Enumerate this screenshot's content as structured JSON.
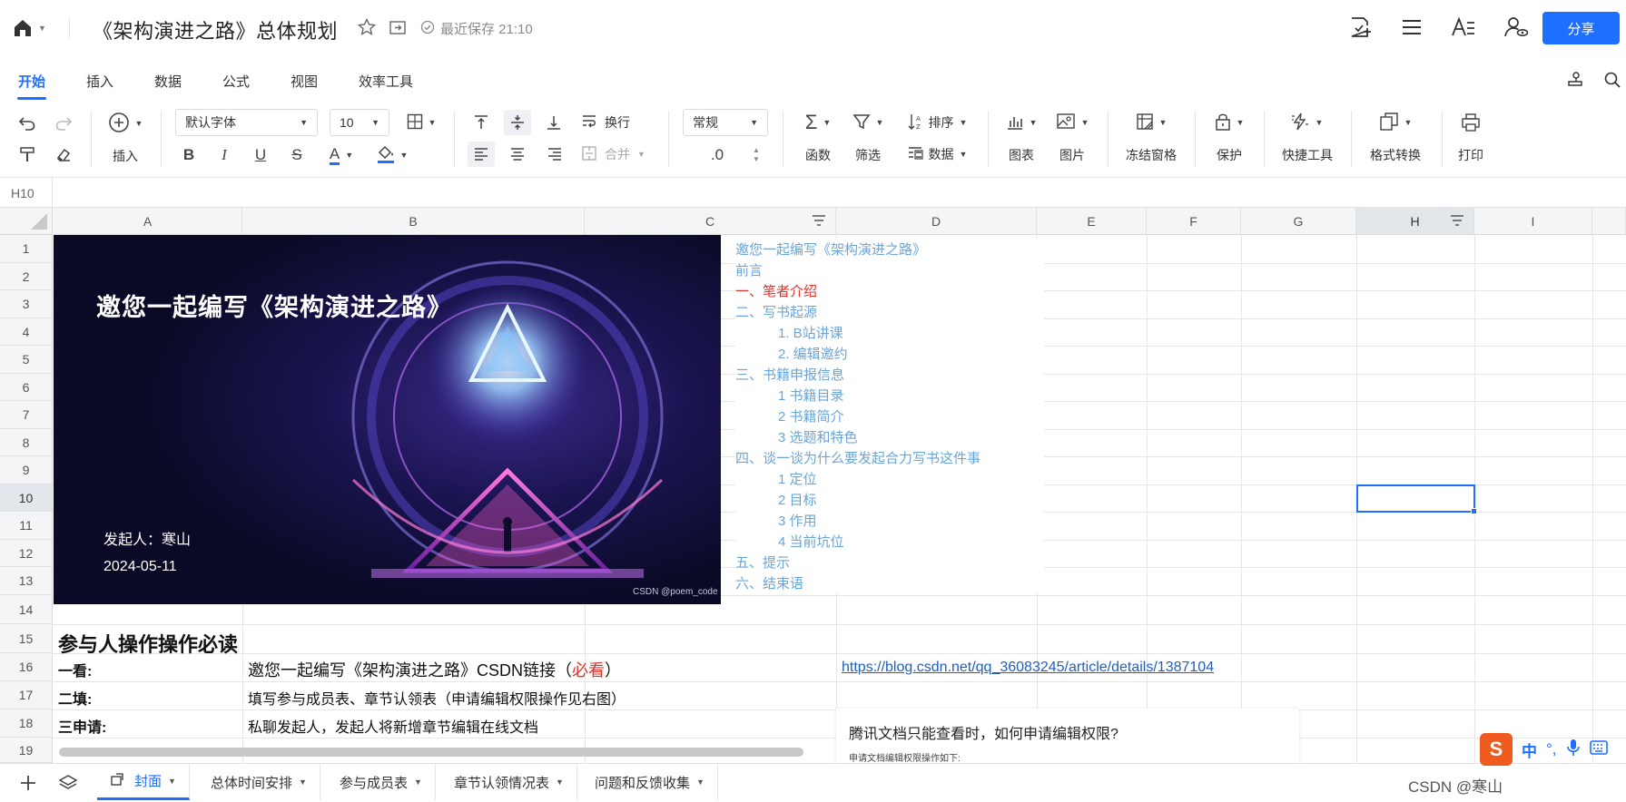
{
  "topbar": {
    "title": "《架构演进之路》总体规划",
    "save_status": "最近保存 21:10",
    "share_label": "分享"
  },
  "menu": {
    "tabs": [
      "开始",
      "插入",
      "数据",
      "公式",
      "视图",
      "效率工具"
    ],
    "active": "开始"
  },
  "toolbar": {
    "insert_label": "插入",
    "font_name": "默认字体",
    "font_size": "10",
    "wrap_label": "换行",
    "merge_label": "合并",
    "number_format": "常规",
    "decimal_label": ".0",
    "sort_label": "排序",
    "data_label": "数据",
    "function_label": "函数",
    "filter_label": "筛选",
    "chart_label": "图表",
    "image_label": "图片",
    "freeze_label": "冻结窗格",
    "protect_label": "保护",
    "quick_tools_label": "快捷工具",
    "format_convert_label": "格式转换",
    "print_label": "打印"
  },
  "formula_bar": {
    "cell_ref": "H10"
  },
  "grid": {
    "columns": [
      "A",
      "B",
      "C",
      "D",
      "E",
      "F",
      "G",
      "H",
      "I"
    ],
    "rows": [
      "1",
      "2",
      "3",
      "4",
      "5",
      "6",
      "7",
      "8",
      "9",
      "10",
      "11",
      "12",
      "13",
      "14",
      "15",
      "16",
      "17",
      "18",
      "19"
    ],
    "selected_column": "H",
    "selected_row": "10"
  },
  "cover": {
    "title": "邀您一起编写《架构演进之路》",
    "sponsor": "发起人：寒山",
    "date": "2024-05-11",
    "watermark": "CSDN @poem_code"
  },
  "toc": [
    {
      "text": "邀您一起编写《架构演进之路》",
      "level": 1,
      "style": "normal"
    },
    {
      "text": "前言",
      "level": 1,
      "style": "normal"
    },
    {
      "text": "一、笔者介绍",
      "level": 1,
      "style": "red"
    },
    {
      "text": "二、写书起源",
      "level": 1,
      "style": "normal"
    },
    {
      "text": "1. B站讲课",
      "level": 2,
      "style": "normal"
    },
    {
      "text": "2. 编辑邀约",
      "level": 2,
      "style": "normal"
    },
    {
      "text": "三、书籍申报信息",
      "level": 1,
      "style": "normal"
    },
    {
      "text": "1 书籍目录",
      "level": 2,
      "style": "normal"
    },
    {
      "text": "2 书籍简介",
      "level": 2,
      "style": "normal"
    },
    {
      "text": "3 选题和特色",
      "level": 2,
      "style": "normal"
    },
    {
      "text": "四、谈一谈为什么要发起合力写书这件事",
      "level": 1,
      "style": "normal"
    },
    {
      "text": "1 定位",
      "level": 2,
      "style": "normal"
    },
    {
      "text": "2 目标",
      "level": 2,
      "style": "normal"
    },
    {
      "text": "3 作用",
      "level": 2,
      "style": "normal"
    },
    {
      "text": "4 当前坑位",
      "level": 2,
      "style": "normal"
    },
    {
      "text": "五、提示",
      "level": 1,
      "style": "normal"
    },
    {
      "text": "六、结束语",
      "level": 1,
      "style": "normal"
    }
  ],
  "rows_content": {
    "heading": "参与人操作操作必读",
    "r16_label": "一看:",
    "r16_text": "邀您一起编写《架构演进之路》CSDN链接（",
    "r16_must": "必看",
    "r16_close": "）",
    "r16_link": "https://blog.csdn.net/qq_36083245/article/details/1387104",
    "r17_label": "二填:",
    "r17_text": "填写参与成员表、章节认领表（申请编辑权限操作见右图）",
    "r18_label": "三申请:",
    "r18_text": "私聊发起人，发起人将新增章节编辑在线文档"
  },
  "popup": {
    "title": "腾讯文档只能查看时，如何申请编辑权限?",
    "subtitle": "申请文档编辑权限操作如下:"
  },
  "sheets": {
    "tabs": [
      "封面",
      "总体时间安排",
      "参与成员表",
      "章节认领情况表",
      "问题和反馈收集"
    ],
    "active": "封面"
  },
  "overlay": {
    "ime_text": "中",
    "ime_punct": "°,",
    "watermark": "CSDN @寒山"
  }
}
